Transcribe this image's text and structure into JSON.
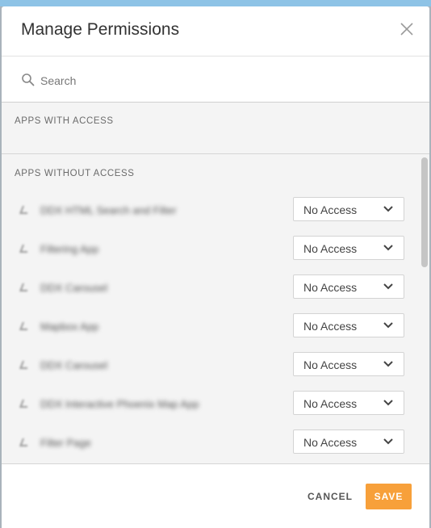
{
  "dialog": {
    "title": "Manage Permissions"
  },
  "search": {
    "placeholder": "Search",
    "value": ""
  },
  "sections": {
    "with_access_label": "APPS WITH ACCESS",
    "without_access_label": "APPS WITHOUT ACCESS"
  },
  "apps_without_access": [
    {
      "name": "DDX HTML Search and Filter",
      "access": "No Access"
    },
    {
      "name": "Filtering App",
      "access": "No Access"
    },
    {
      "name": "DDX Carousel",
      "access": "No Access"
    },
    {
      "name": "Mapbox App",
      "access": "No Access"
    },
    {
      "name": "DDX Carousel",
      "access": "No Access"
    },
    {
      "name": "DDX Interactive Phoenix Map App",
      "access": "No Access"
    },
    {
      "name": "Filter Page",
      "access": "No Access"
    }
  ],
  "footer": {
    "cancel_label": "CANCEL",
    "save_label": "SAVE"
  },
  "colors": {
    "accent": "#f7a03a",
    "section_bg": "#f4f4f4"
  },
  "icons": {
    "close": "close-icon",
    "search": "search-icon",
    "app": "app-icon",
    "dropdown": "chevron-down-icon"
  }
}
